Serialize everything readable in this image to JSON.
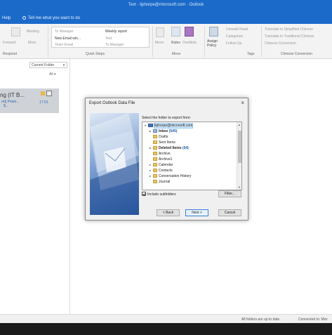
{
  "window": {
    "title": "Text · tiphorpe@microsoft.com · Outlook"
  },
  "menubar": {
    "help": "Help",
    "tell_me": "Tell me what you want to do"
  },
  "ribbon": {
    "respond_group": "Respond",
    "respond_buttons": [
      "Meeting",
      "Forward",
      "More"
    ],
    "quick_steps_group": "Quick Steps",
    "quick_steps": [
      "To Manager",
      "New Email win...",
      "Team Email",
      "Weekly report",
      "Test",
      "To Manager"
    ],
    "move_group": "Move",
    "move_buttons": [
      "Move",
      "Rules",
      "OneNote"
    ],
    "tags_group": "Tags",
    "assign_policy": "Assign Policy",
    "tags_buttons": [
      "Unread/ Read",
      "Categorize",
      "Follow Up"
    ],
    "chinese_group": "Chinese Conversion",
    "chinese_buttons": [
      "Translate to Simplified Chinese",
      "Translate to Traditional Chinese",
      "Chinese Conversion"
    ]
  },
  "folderpane": {
    "folder_scope": "Current Folder",
    "filter": "All",
    "mail_item": {
      "title": "ng (IT B...",
      "line2": "ret] Powe...",
      "time": "17:01",
      "cal": "$..."
    }
  },
  "dialog": {
    "title": "Export Outlook Data File",
    "close": "×",
    "instruction": "Select the folder to export from:",
    "tree": [
      {
        "label": "tiphorpe@microsoft.com",
        "count": "",
        "level": 0,
        "expander": "▾",
        "icon": "mailbox",
        "selected": true,
        "bold": false
      },
      {
        "label": "Inbox",
        "count": "(545)",
        "level": 1,
        "expander": "▸",
        "icon": "inbox",
        "selected": false,
        "bold": true
      },
      {
        "label": "Drafts",
        "count": "",
        "level": 1,
        "expander": "",
        "icon": "folder",
        "selected": false,
        "bold": false
      },
      {
        "label": "Sent Items",
        "count": "",
        "level": 1,
        "expander": "",
        "icon": "folder",
        "selected": false,
        "bold": false
      },
      {
        "label": "Deleted Items",
        "count": "(54)",
        "level": 1,
        "expander": "▸",
        "icon": "folder",
        "selected": false,
        "bold": true
      },
      {
        "label": "Archive",
        "count": "",
        "level": 1,
        "expander": "",
        "icon": "folder",
        "selected": false,
        "bold": false
      },
      {
        "label": "Archive1",
        "count": "",
        "level": 1,
        "expander": "",
        "icon": "folder",
        "selected": false,
        "bold": false
      },
      {
        "label": "Calendar",
        "count": "",
        "level": 1,
        "expander": "▸",
        "icon": "folder",
        "selected": false,
        "bold": false
      },
      {
        "label": "Contacts",
        "count": "",
        "level": 1,
        "expander": "▸",
        "icon": "folder",
        "selected": false,
        "bold": false
      },
      {
        "label": "Conversation History",
        "count": "",
        "level": 1,
        "expander": "▸",
        "icon": "folder",
        "selected": false,
        "bold": false
      },
      {
        "label": "Journal",
        "count": "",
        "level": 1,
        "expander": "",
        "icon": "folder",
        "selected": false,
        "bold": false
      }
    ],
    "include_subfolders": "Include subfolders",
    "include_subfolders_checked": true,
    "filter_button": "Filter...",
    "back_button": "< Back",
    "next_button": "Next >",
    "cancel_button": "Cancel"
  },
  "statusbar": {
    "sync": "All folders are up to date.",
    "connection": "Connected to: Micr"
  },
  "colors": {
    "accent": "#1b6ac9",
    "selection": "#cce4f7"
  }
}
